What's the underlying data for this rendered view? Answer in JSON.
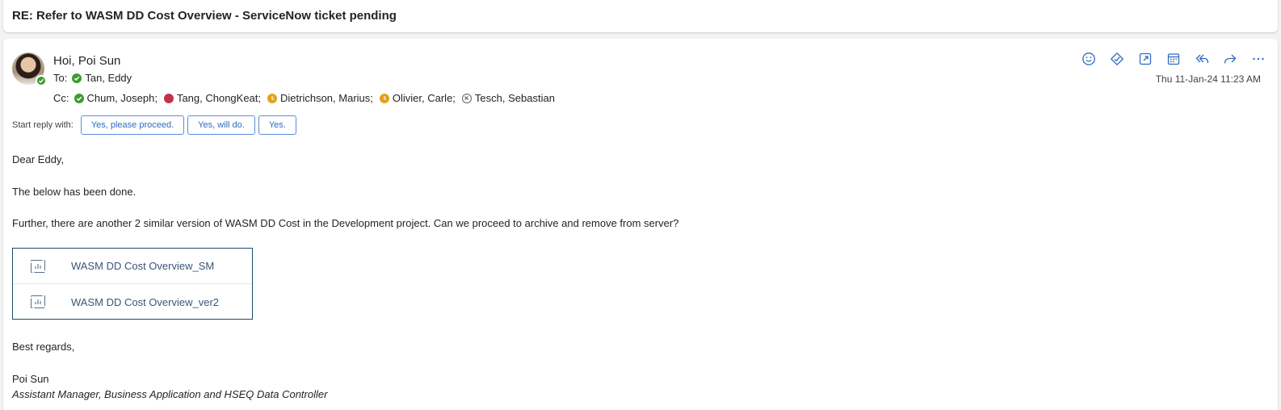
{
  "subject": "RE: Refer to WASM DD Cost Overview - ServiceNow ticket pending",
  "sender": {
    "name": "Hoi, Poi Sun",
    "presence": "available"
  },
  "to": {
    "label": "To:",
    "recipients": [
      {
        "name": "Tan, Eddy",
        "status": "available"
      }
    ]
  },
  "cc": {
    "label": "Cc:",
    "recipients": [
      {
        "name": "Chum, Joseph;",
        "status": "available"
      },
      {
        "name": "Tang, ChongKeat;",
        "status": "busy"
      },
      {
        "name": "Dietrichson, Marius;",
        "status": "away"
      },
      {
        "name": "Olivier, Carle;",
        "status": "away"
      },
      {
        "name": "Tesch, Sebastian",
        "status": "offline"
      }
    ]
  },
  "timestamp": "Thu 11-Jan-24 11:23 AM",
  "actions": [
    "smile-icon",
    "loop-icon",
    "open-in-window-icon",
    "calendar-icon",
    "reply-all-icon",
    "forward-icon",
    "more-icon"
  ],
  "quick_reply": {
    "label": "Start reply with:",
    "options": [
      "Yes, please proceed.",
      "Yes, will do.",
      "Yes."
    ]
  },
  "body": {
    "greeting": "Dear Eddy,",
    "para1": "The below has been done.",
    "para2": "Further, there are another 2 similar version of WASM DD Cost in the Development project. Can we proceed to archive and remove from server?",
    "attachments": [
      "WASM DD Cost Overview_SM",
      "WASM DD Cost Overview_ver2"
    ],
    "closing": "Best regards,",
    "signature_name": "Poi Sun",
    "signature_title": "Assistant Manager, Business Application and HSEQ Data Controller"
  },
  "colors": {
    "available": "#3c9b2e",
    "busy": "#c4314b",
    "away": "#e3a21a",
    "accent": "#2f6bc0"
  }
}
